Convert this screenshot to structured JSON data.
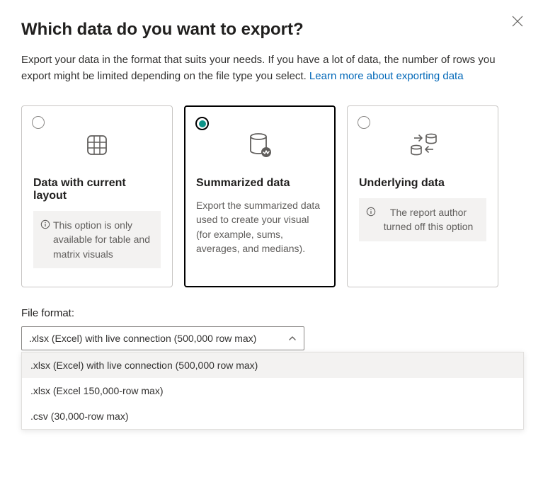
{
  "dialog": {
    "title": "Which data do you want to export?",
    "subtitle_prefix": "Export your data in the format that suits your needs. If you have a lot of data, the number of rows you export might be limited depending on the file type you select.  ",
    "learn_more_label": "Learn more about exporting data"
  },
  "options": {
    "layout": {
      "title": "Data with current layout",
      "note": "This option is only available for table and matrix visuals"
    },
    "summarized": {
      "title": "Summarized data",
      "note": "Export the summarized data used to create your visual (for example, sums, averages, and medians)."
    },
    "underlying": {
      "title": "Underlying data",
      "note": "The report author turned off this option"
    }
  },
  "file_format": {
    "label": "File format:",
    "selected": ".xlsx (Excel) with live connection (500,000 row max)",
    "options": [
      ".xlsx (Excel) with live connection (500,000 row max)",
      ".xlsx (Excel 150,000-row max)",
      ".csv (30,000-row max)"
    ]
  },
  "icons": {
    "close": "close-icon",
    "info": "info-icon",
    "grid": "grid-icon",
    "database": "database-icon",
    "sync": "sync-databases-icon",
    "chevron_up": "chevron-up-icon"
  }
}
